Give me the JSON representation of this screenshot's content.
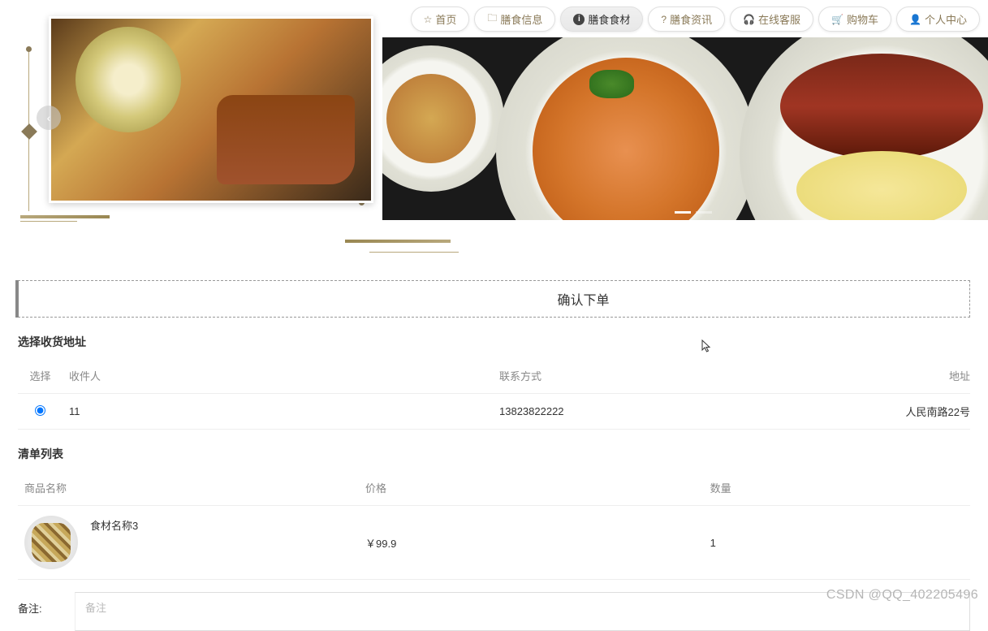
{
  "nav": [
    {
      "icon": "☆",
      "label": "首页",
      "active": false
    },
    {
      "icon": "🗀",
      "label": "膳食信息",
      "active": false
    },
    {
      "icon": "ⓘ",
      "label": "膳食食材",
      "active": true
    },
    {
      "icon": "?",
      "label": "膳食资讯",
      "active": false
    },
    {
      "icon": "🎧",
      "label": "在线客服",
      "active": false
    },
    {
      "icon": "🛒",
      "label": "购物车",
      "active": false
    },
    {
      "icon": "👤",
      "label": "个人中心",
      "active": false
    }
  ],
  "confirm_label": "确认下单",
  "sections": {
    "address_title": "选择收货地址",
    "items_title": "清单列表"
  },
  "address_table": {
    "headers": {
      "select": "选择",
      "recipient": "收件人",
      "contact": "联系方式",
      "address": "地址"
    },
    "rows": [
      {
        "selected": true,
        "recipient": "11",
        "contact": "13823822222",
        "address": "人民南路22号"
      }
    ]
  },
  "items_table": {
    "headers": {
      "name": "商品名称",
      "price": "价格",
      "qty": "数量"
    },
    "rows": [
      {
        "name": "食材名称3",
        "price": "￥99.9",
        "qty": "1"
      }
    ]
  },
  "remark": {
    "label": "备注:",
    "placeholder": "备注"
  },
  "watermark": "CSDN @QQ_402205496"
}
